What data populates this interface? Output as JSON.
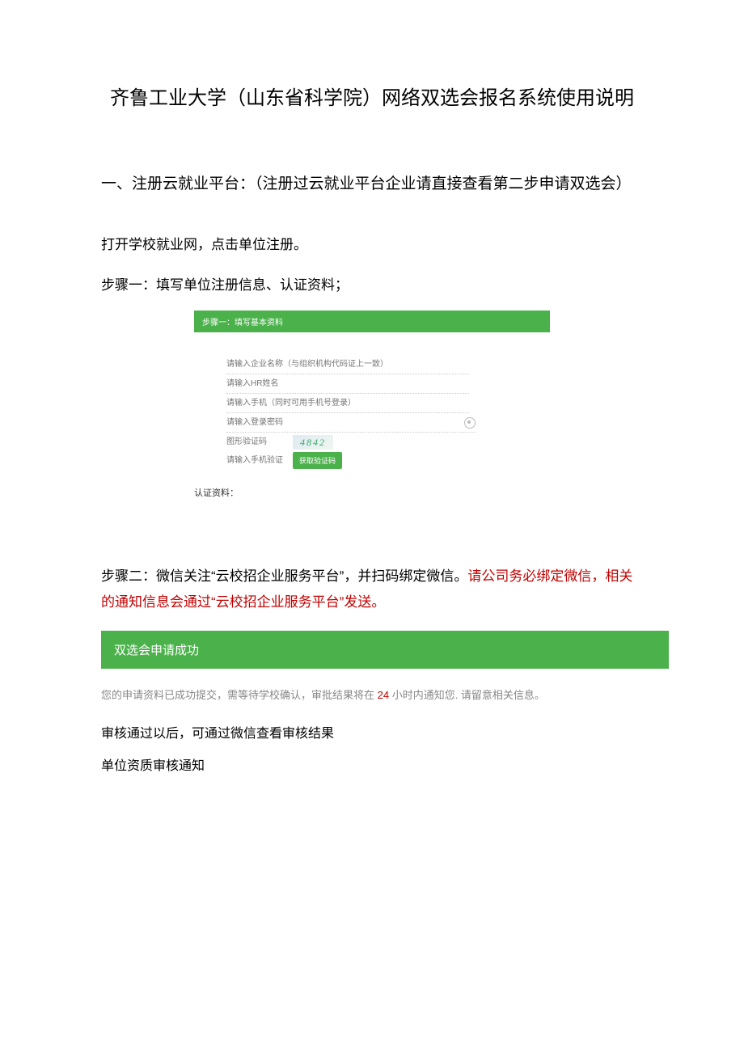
{
  "title": "齐鲁工业大学（山东省科学院）网络双选会报名系统使用说明",
  "section1_heading": "一、注册云就业平台：（注册过云就业平台企业请直接查看第二步申请双选会）",
  "intro1": "打开学校就业网，点击单位注册。",
  "intro2": "步骤一：填写单位注册信息、认证资料；",
  "form": {
    "header": "步骤一：填写基本资料",
    "company_placeholder": "请输入企业名称（与组织机构代码证上一致）",
    "contact_placeholder": "请输入HR姓名",
    "phone_placeholder": "请输入手机（同时可用手机号登录）",
    "password_placeholder": "请输入登录密码",
    "captcha_label": "图形验证码",
    "captcha_value": "4842",
    "sms_placeholder": "请输入手机验证码",
    "sms_button": "获取验证码",
    "renzhi_label": "认证资料："
  },
  "step2_text_black": "步骤二：微信关注“云校招企业服务平台”，并扫码绑定微信。",
  "step2_text_red": "请公司务必绑定微信，相关的通知信息会通过“云校招企业服务平台”发送。",
  "success_bar": "双选会申请成功",
  "submit_note_before": "您的申请资料已成功提交，需等待学校确认，审批结果将在 ",
  "submit_note_hours": "24",
  "submit_note_after": " 小时内通知您. 请留意相关信息。",
  "after1": "审核通过以后，可通过微信查看审核结果",
  "after2": "单位资质审核通知"
}
